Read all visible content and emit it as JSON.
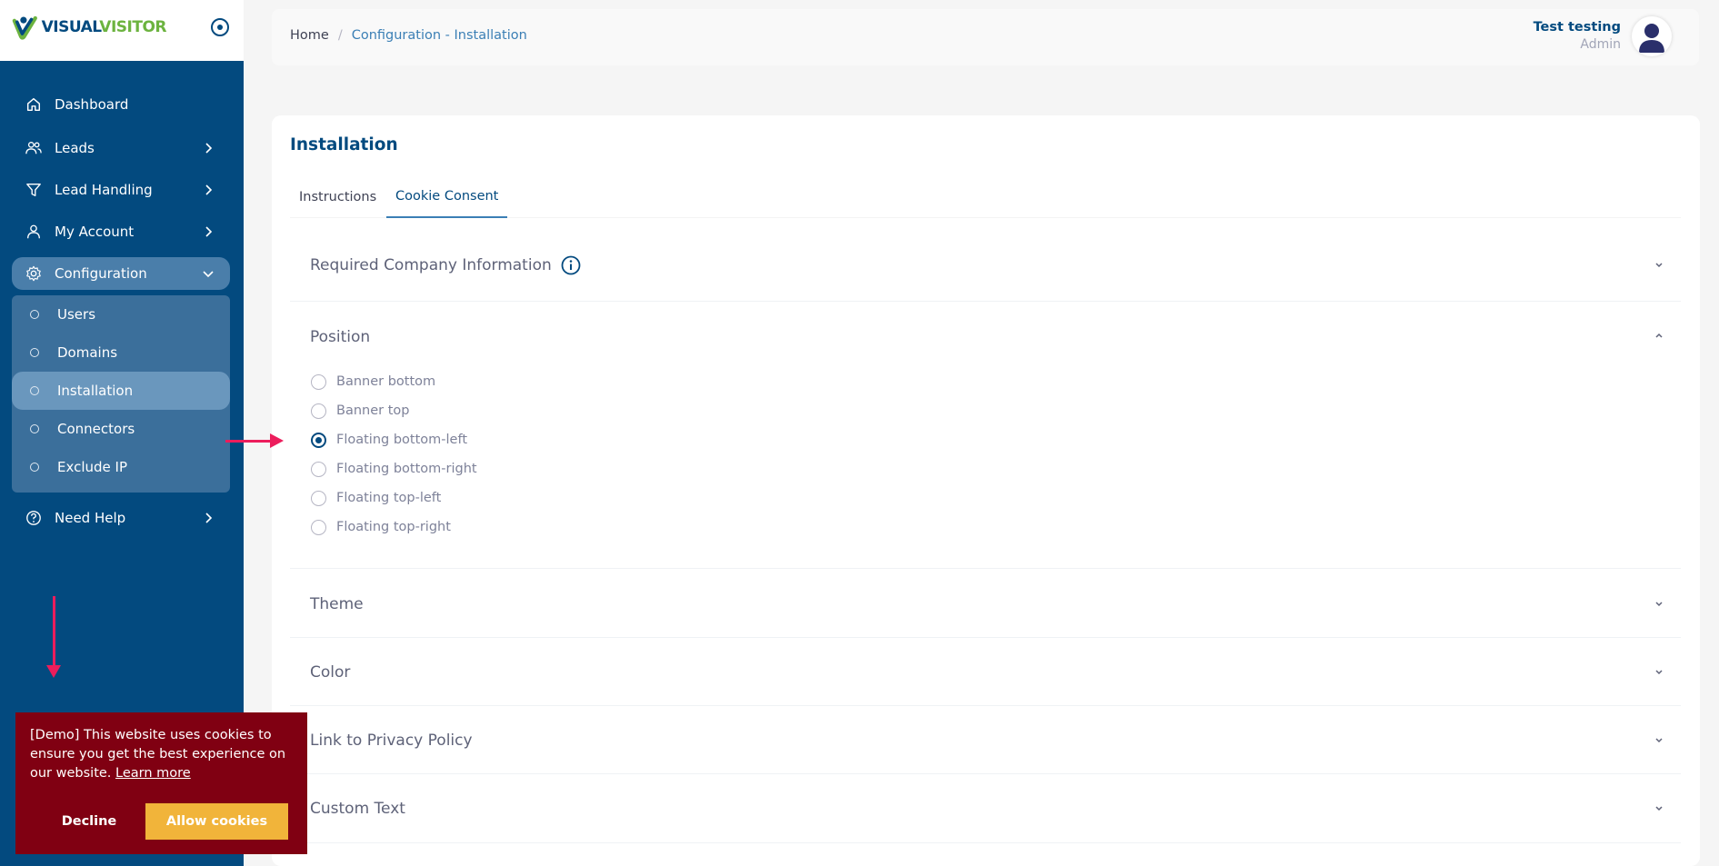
{
  "brand": {
    "part1": "VISUAL",
    "part2": "VISITOR"
  },
  "sidebar": {
    "items": [
      {
        "label": "Dashboard"
      },
      {
        "label": "Leads"
      },
      {
        "label": "Lead Handling"
      },
      {
        "label": "My Account"
      },
      {
        "label": "Configuration"
      },
      {
        "label": "Need Help"
      }
    ],
    "configuration_subitems": [
      {
        "label": "Users"
      },
      {
        "label": "Domains"
      },
      {
        "label": "Installation"
      },
      {
        "label": "Connectors"
      },
      {
        "label": "Exclude IP"
      }
    ]
  },
  "breadcrumb": {
    "home": "Home",
    "separator": "/",
    "current": "Configuration - Installation"
  },
  "user": {
    "name": "Test testing",
    "role": "Admin"
  },
  "card": {
    "title": "Installation",
    "tabs": [
      {
        "label": "Instructions"
      },
      {
        "label": "Cookie Consent"
      }
    ],
    "sections": [
      {
        "title": "Required Company Information"
      },
      {
        "title": "Position"
      },
      {
        "title": "Theme"
      },
      {
        "title": "Color"
      },
      {
        "title": "Link to Privacy Policy"
      },
      {
        "title": "Custom Text"
      }
    ],
    "position_options": [
      {
        "label": "Banner bottom"
      },
      {
        "label": "Banner top"
      },
      {
        "label": "Floating bottom-left"
      },
      {
        "label": "Floating bottom-right"
      },
      {
        "label": "Floating top-left"
      },
      {
        "label": "Floating top-right"
      }
    ],
    "selected_position": "Floating bottom-left"
  },
  "cookie_banner": {
    "text": "[Demo] This website uses cookies to ensure you get the best experience on our website.",
    "link": "Learn more",
    "decline_label": "Decline",
    "allow_label": "Allow cookies"
  },
  "colors": {
    "sidebar_bg": "#034a7f",
    "brand_green": "#6cb33f",
    "accent_blue": "#3b7fb5",
    "annotation_arrow": "#ec1d5c",
    "cookie_bg": "#800012",
    "cookie_button": "#f1b43a"
  }
}
